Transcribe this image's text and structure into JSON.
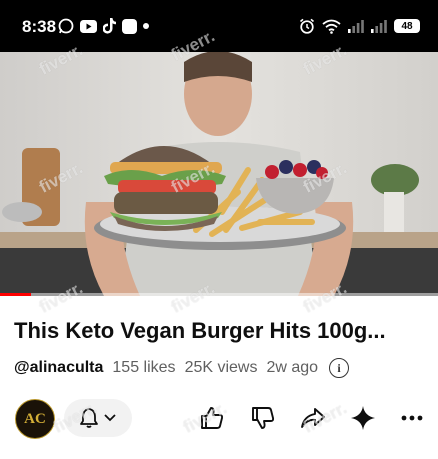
{
  "status_bar": {
    "time": "8:38",
    "battery": "48",
    "left_icons": [
      "whatsapp-icon",
      "youtube-icon",
      "tiktok-icon",
      "app-icon",
      "dot-icon"
    ],
    "right_icons": [
      "alarm-icon",
      "wifi-icon",
      "signal-icon",
      "signal-icon",
      "battery-icon"
    ]
  },
  "video": {
    "watermark": "fiverr.",
    "progress": 0.07,
    "progress_color": "#ff0000"
  },
  "info": {
    "title": "This Keto Vegan Burger Hits 100g...",
    "channel_handle": "@alinaculta",
    "likes": "155 likes",
    "views": "25K views",
    "age": "2w ago",
    "info_icon": "i"
  },
  "actions": {
    "avatar_text": "AC",
    "icons": [
      "bell-icon",
      "chevron-down-icon",
      "like-icon",
      "dislike-icon",
      "share-icon",
      "remix-sparkle-icon",
      "more-icon"
    ]
  }
}
